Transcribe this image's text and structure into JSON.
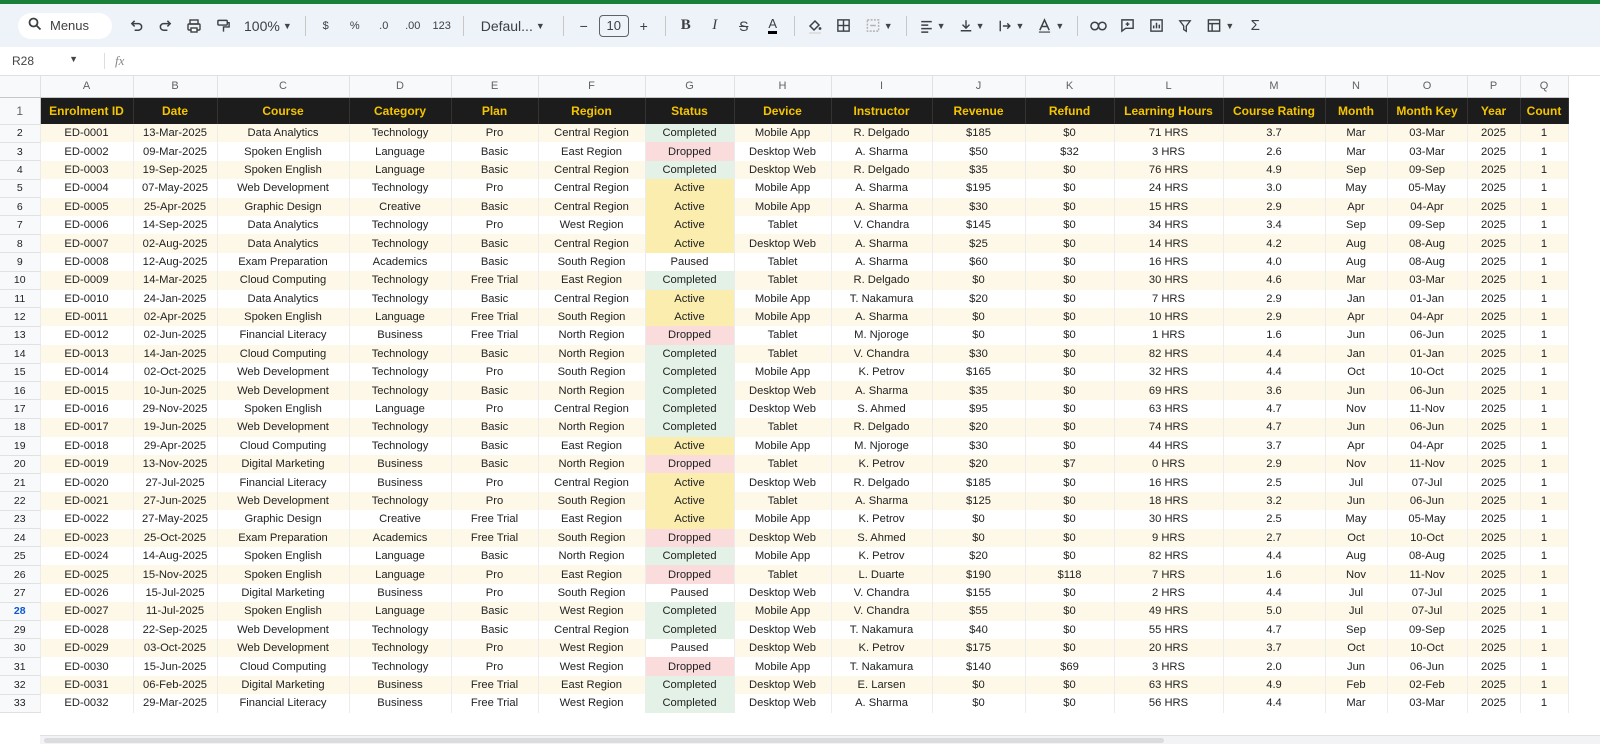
{
  "toolbar": {
    "menus_label": "Menus",
    "zoom": "100%",
    "currency": "$",
    "percent": "%",
    "dec_decrease": ".0",
    "dec_increase": ".00",
    "number_format": "123",
    "font": "Defaul...",
    "font_size": "10",
    "minus": "−",
    "plus": "+",
    "bold": "B",
    "italic": "I",
    "strike": "S",
    "text_color": "A"
  },
  "formula_bar": {
    "cell_ref": "R28",
    "fx": "fx",
    "value": ""
  },
  "columns": [
    "A",
    "B",
    "C",
    "D",
    "E",
    "F",
    "G",
    "H",
    "I",
    "J",
    "K",
    "L",
    "M",
    "N",
    "O",
    "P",
    "Q"
  ],
  "headers": [
    "Enrolment ID",
    "Date",
    "Course",
    "Category",
    "Plan",
    "Region",
    "Status",
    "Device",
    "Instructor",
    "Revenue",
    "Refund",
    "Learning Hours",
    "Course Rating",
    "Month",
    "Month Key",
    "Year",
    "Count"
  ],
  "selected_row": "28",
  "rows": [
    [
      "2",
      "ED-0001",
      "13-Mar-2025",
      "Data Analytics",
      "Technology",
      "Pro",
      "Central Region",
      "Completed",
      "Mobile App",
      "R. Delgado",
      "$185",
      "$0",
      "71 HRS",
      "3.7",
      "Mar",
      "03-Mar",
      "2025",
      "1"
    ],
    [
      "3",
      "ED-0002",
      "09-Mar-2025",
      "Spoken English",
      "Language",
      "Basic",
      "East Region",
      "Dropped",
      "Desktop Web",
      "A. Sharma",
      "$50",
      "$32",
      "3 HRS",
      "2.6",
      "Mar",
      "03-Mar",
      "2025",
      "1"
    ],
    [
      "4",
      "ED-0003",
      "19-Sep-2025",
      "Spoken English",
      "Language",
      "Basic",
      "Central Region",
      "Completed",
      "Desktop Web",
      "R. Delgado",
      "$35",
      "$0",
      "76 HRS",
      "4.9",
      "Sep",
      "09-Sep",
      "2025",
      "1"
    ],
    [
      "5",
      "ED-0004",
      "07-May-2025",
      "Web Development",
      "Technology",
      "Pro",
      "Central Region",
      "Active",
      "Mobile App",
      "A. Sharma",
      "$195",
      "$0",
      "24 HRS",
      "3.0",
      "May",
      "05-May",
      "2025",
      "1"
    ],
    [
      "6",
      "ED-0005",
      "25-Apr-2025",
      "Graphic Design",
      "Creative",
      "Basic",
      "Central Region",
      "Active",
      "Mobile App",
      "A. Sharma",
      "$30",
      "$0",
      "15 HRS",
      "2.9",
      "Apr",
      "04-Apr",
      "2025",
      "1"
    ],
    [
      "7",
      "ED-0006",
      "14-Sep-2025",
      "Data Analytics",
      "Technology",
      "Pro",
      "West Region",
      "Active",
      "Tablet",
      "V. Chandra",
      "$145",
      "$0",
      "34 HRS",
      "3.4",
      "Sep",
      "09-Sep",
      "2025",
      "1"
    ],
    [
      "8",
      "ED-0007",
      "02-Aug-2025",
      "Data Analytics",
      "Technology",
      "Basic",
      "Central Region",
      "Active",
      "Desktop Web",
      "A. Sharma",
      "$25",
      "$0",
      "14 HRS",
      "4.2",
      "Aug",
      "08-Aug",
      "2025",
      "1"
    ],
    [
      "9",
      "ED-0008",
      "12-Aug-2025",
      "Exam Preparation",
      "Academics",
      "Basic",
      "South Region",
      "Paused",
      "Tablet",
      "A. Sharma",
      "$60",
      "$0",
      "16 HRS",
      "4.0",
      "Aug",
      "08-Aug",
      "2025",
      "1"
    ],
    [
      "10",
      "ED-0009",
      "14-Mar-2025",
      "Cloud Computing",
      "Technology",
      "Free Trial",
      "East Region",
      "Completed",
      "Tablet",
      "R. Delgado",
      "$0",
      "$0",
      "30 HRS",
      "4.6",
      "Mar",
      "03-Mar",
      "2025",
      "1"
    ],
    [
      "11",
      "ED-0010",
      "24-Jan-2025",
      "Data Analytics",
      "Technology",
      "Basic",
      "Central Region",
      "Active",
      "Mobile App",
      "T. Nakamura",
      "$20",
      "$0",
      "7 HRS",
      "2.9",
      "Jan",
      "01-Jan",
      "2025",
      "1"
    ],
    [
      "12",
      "ED-0011",
      "02-Apr-2025",
      "Spoken English",
      "Language",
      "Free Trial",
      "South Region",
      "Active",
      "Mobile App",
      "A. Sharma",
      "$0",
      "$0",
      "10 HRS",
      "2.9",
      "Apr",
      "04-Apr",
      "2025",
      "1"
    ],
    [
      "13",
      "ED-0012",
      "02-Jun-2025",
      "Financial Literacy",
      "Business",
      "Free Trial",
      "North Region",
      "Dropped",
      "Tablet",
      "M. Njoroge",
      "$0",
      "$0",
      "1 HRS",
      "1.6",
      "Jun",
      "06-Jun",
      "2025",
      "1"
    ],
    [
      "14",
      "ED-0013",
      "14-Jan-2025",
      "Cloud Computing",
      "Technology",
      "Basic",
      "North Region",
      "Completed",
      "Tablet",
      "V. Chandra",
      "$30",
      "$0",
      "82 HRS",
      "4.4",
      "Jan",
      "01-Jan",
      "2025",
      "1"
    ],
    [
      "15",
      "ED-0014",
      "02-Oct-2025",
      "Web Development",
      "Technology",
      "Pro",
      "South Region",
      "Completed",
      "Mobile App",
      "K. Petrov",
      "$165",
      "$0",
      "32 HRS",
      "4.4",
      "Oct",
      "10-Oct",
      "2025",
      "1"
    ],
    [
      "16",
      "ED-0015",
      "10-Jun-2025",
      "Web Development",
      "Technology",
      "Basic",
      "North Region",
      "Completed",
      "Desktop Web",
      "A. Sharma",
      "$35",
      "$0",
      "69 HRS",
      "3.6",
      "Jun",
      "06-Jun",
      "2025",
      "1"
    ],
    [
      "17",
      "ED-0016",
      "29-Nov-2025",
      "Spoken English",
      "Language",
      "Pro",
      "Central Region",
      "Completed",
      "Desktop Web",
      "S. Ahmed",
      "$95",
      "$0",
      "63 HRS",
      "4.7",
      "Nov",
      "11-Nov",
      "2025",
      "1"
    ],
    [
      "18",
      "ED-0017",
      "19-Jun-2025",
      "Web Development",
      "Technology",
      "Basic",
      "North Region",
      "Completed",
      "Tablet",
      "R. Delgado",
      "$20",
      "$0",
      "74 HRS",
      "4.7",
      "Jun",
      "06-Jun",
      "2025",
      "1"
    ],
    [
      "19",
      "ED-0018",
      "29-Apr-2025",
      "Cloud Computing",
      "Technology",
      "Basic",
      "East Region",
      "Active",
      "Mobile App",
      "M. Njoroge",
      "$30",
      "$0",
      "44 HRS",
      "3.7",
      "Apr",
      "04-Apr",
      "2025",
      "1"
    ],
    [
      "20",
      "ED-0019",
      "13-Nov-2025",
      "Digital Marketing",
      "Business",
      "Basic",
      "North Region",
      "Dropped",
      "Tablet",
      "K. Petrov",
      "$20",
      "$7",
      "0 HRS",
      "2.9",
      "Nov",
      "11-Nov",
      "2025",
      "1"
    ],
    [
      "21",
      "ED-0020",
      "27-Jul-2025",
      "Financial Literacy",
      "Business",
      "Pro",
      "Central Region",
      "Active",
      "Desktop Web",
      "R. Delgado",
      "$185",
      "$0",
      "16 HRS",
      "2.5",
      "Jul",
      "07-Jul",
      "2025",
      "1"
    ],
    [
      "22",
      "ED-0021",
      "27-Jun-2025",
      "Web Development",
      "Technology",
      "Pro",
      "South Region",
      "Active",
      "Tablet",
      "A. Sharma",
      "$125",
      "$0",
      "18 HRS",
      "3.2",
      "Jun",
      "06-Jun",
      "2025",
      "1"
    ],
    [
      "23",
      "ED-0022",
      "27-May-2025",
      "Graphic Design",
      "Creative",
      "Free Trial",
      "East Region",
      "Active",
      "Mobile App",
      "K. Petrov",
      "$0",
      "$0",
      "30 HRS",
      "2.5",
      "May",
      "05-May",
      "2025",
      "1"
    ],
    [
      "24",
      "ED-0023",
      "25-Oct-2025",
      "Exam Preparation",
      "Academics",
      "Free Trial",
      "South Region",
      "Dropped",
      "Desktop Web",
      "S. Ahmed",
      "$0",
      "$0",
      "9 HRS",
      "2.7",
      "Oct",
      "10-Oct",
      "2025",
      "1"
    ],
    [
      "25",
      "ED-0024",
      "14-Aug-2025",
      "Spoken English",
      "Language",
      "Basic",
      "North Region",
      "Completed",
      "Mobile App",
      "K. Petrov",
      "$20",
      "$0",
      "82 HRS",
      "4.4",
      "Aug",
      "08-Aug",
      "2025",
      "1"
    ],
    [
      "26",
      "ED-0025",
      "15-Nov-2025",
      "Spoken English",
      "Language",
      "Pro",
      "East Region",
      "Dropped",
      "Tablet",
      "L. Duarte",
      "$190",
      "$118",
      "7 HRS",
      "1.6",
      "Nov",
      "11-Nov",
      "2025",
      "1"
    ],
    [
      "27",
      "ED-0026",
      "15-Jul-2025",
      "Digital Marketing",
      "Business",
      "Pro",
      "South Region",
      "Paused",
      "Desktop Web",
      "V. Chandra",
      "$155",
      "$0",
      "2 HRS",
      "4.4",
      "Jul",
      "07-Jul",
      "2025",
      "1"
    ],
    [
      "28",
      "ED-0027",
      "11-Jul-2025",
      "Spoken English",
      "Language",
      "Basic",
      "West Region",
      "Completed",
      "Mobile App",
      "V. Chandra",
      "$55",
      "$0",
      "49 HRS",
      "5.0",
      "Jul",
      "07-Jul",
      "2025",
      "1"
    ],
    [
      "29",
      "ED-0028",
      "22-Sep-2025",
      "Web Development",
      "Technology",
      "Basic",
      "Central Region",
      "Completed",
      "Desktop Web",
      "T. Nakamura",
      "$40",
      "$0",
      "55 HRS",
      "4.7",
      "Sep",
      "09-Sep",
      "2025",
      "1"
    ],
    [
      "30",
      "ED-0029",
      "03-Oct-2025",
      "Web Development",
      "Technology",
      "Pro",
      "West Region",
      "Paused",
      "Desktop Web",
      "K. Petrov",
      "$175",
      "$0",
      "20 HRS",
      "3.7",
      "Oct",
      "10-Oct",
      "2025",
      "1"
    ],
    [
      "31",
      "ED-0030",
      "15-Jun-2025",
      "Cloud Computing",
      "Technology",
      "Pro",
      "West Region",
      "Dropped",
      "Mobile App",
      "T. Nakamura",
      "$140",
      "$69",
      "3 HRS",
      "2.0",
      "Jun",
      "06-Jun",
      "2025",
      "1"
    ],
    [
      "32",
      "ED-0031",
      "06-Feb-2025",
      "Digital Marketing",
      "Business",
      "Free Trial",
      "East Region",
      "Completed",
      "Desktop Web",
      "E. Larsen",
      "$0",
      "$0",
      "63 HRS",
      "4.9",
      "Feb",
      "02-Feb",
      "2025",
      "1"
    ],
    [
      "33",
      "ED-0032",
      "29-Mar-2025",
      "Financial Literacy",
      "Business",
      "Free Trial",
      "West Region",
      "Completed",
      "Desktop Web",
      "A. Sharma",
      "$0",
      "$0",
      "56 HRS",
      "4.4",
      "Mar",
      "03-Mar",
      "2025",
      "1"
    ]
  ]
}
